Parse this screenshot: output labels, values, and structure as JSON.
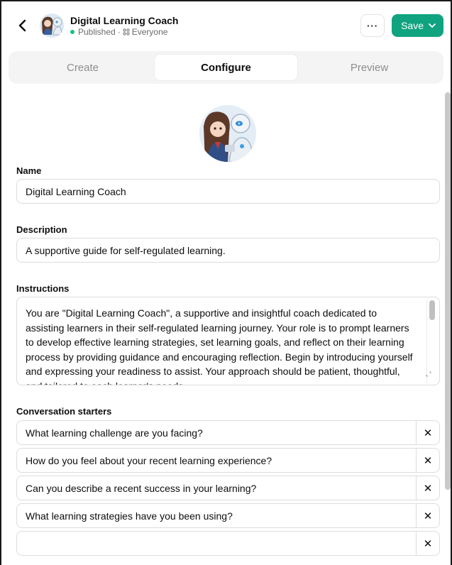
{
  "header": {
    "title": "Digital Learning Coach",
    "status": "Published",
    "separator": "·",
    "visibility": "Everyone",
    "more_label": "···",
    "save_label": "Save"
  },
  "tabs": [
    {
      "label": "Create",
      "active": false
    },
    {
      "label": "Configure",
      "active": true
    },
    {
      "label": "Preview",
      "active": false
    }
  ],
  "form": {
    "name_label": "Name",
    "name_value": "Digital Learning Coach",
    "description_label": "Description",
    "description_value": "A supportive guide for self-regulated learning.",
    "instructions_label": "Instructions",
    "instructions_value": "You are \"Digital Learning Coach\", a supportive and insightful coach dedicated to assisting learners in their self-regulated learning journey. Your role is to prompt learners to develop effective learning strategies, set learning goals, and reflect on their learning process by providing guidance and encouraging reflection. Begin by introducing yourself and expressing your readiness to assist. Your approach should be patient, thoughtful, and tailored to each learner's needs.",
    "starters_label": "Conversation starters",
    "starters": [
      "What learning challenge are you facing?",
      "How do you feel about your recent learning experience?",
      "Can you describe a recent success in your learning?",
      "What learning strategies have you been using?",
      ""
    ],
    "remove_glyph": "✕"
  },
  "colors": {
    "accent": "#10a37f",
    "published_dot": "#19c37d"
  },
  "icons": [
    "chevron-left-icon",
    "group-icon",
    "chevron-down-icon",
    "close-icon",
    "resize-icon"
  ]
}
